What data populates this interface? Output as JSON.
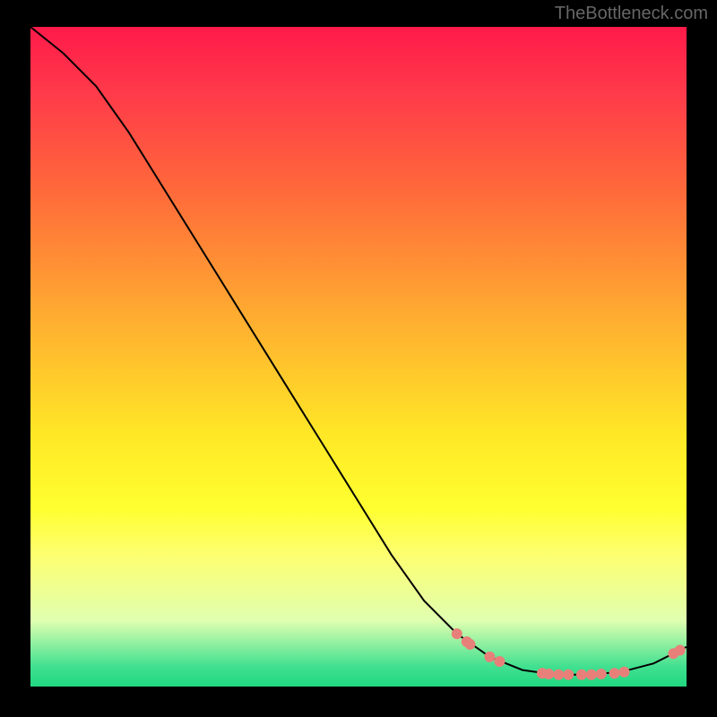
{
  "watermark": "TheBottleneck.com",
  "chart_data": {
    "type": "line",
    "title": "",
    "xlabel": "",
    "ylabel": "",
    "xlim": [
      0,
      100
    ],
    "ylim": [
      0,
      100
    ],
    "curve": [
      {
        "x": 0,
        "y": 100
      },
      {
        "x": 5,
        "y": 96
      },
      {
        "x": 10,
        "y": 91
      },
      {
        "x": 15,
        "y": 84
      },
      {
        "x": 20,
        "y": 76
      },
      {
        "x": 25,
        "y": 68
      },
      {
        "x": 30,
        "y": 60
      },
      {
        "x": 35,
        "y": 52
      },
      {
        "x": 40,
        "y": 44
      },
      {
        "x": 45,
        "y": 36
      },
      {
        "x": 50,
        "y": 28
      },
      {
        "x": 55,
        "y": 20
      },
      {
        "x": 60,
        "y": 13
      },
      {
        "x": 65,
        "y": 8
      },
      {
        "x": 70,
        "y": 4.5
      },
      {
        "x": 75,
        "y": 2.5
      },
      {
        "x": 80,
        "y": 1.8
      },
      {
        "x": 85,
        "y": 1.8
      },
      {
        "x": 90,
        "y": 2.2
      },
      {
        "x": 95,
        "y": 3.5
      },
      {
        "x": 100,
        "y": 6
      }
    ],
    "markers": [
      {
        "x": 65,
        "y": 8
      },
      {
        "x": 66.5,
        "y": 6.8
      },
      {
        "x": 67,
        "y": 6.4
      },
      {
        "x": 70,
        "y": 4.5
      },
      {
        "x": 71.5,
        "y": 3.8
      },
      {
        "x": 78,
        "y": 2.0
      },
      {
        "x": 79,
        "y": 1.9
      },
      {
        "x": 80.5,
        "y": 1.8
      },
      {
        "x": 82,
        "y": 1.8
      },
      {
        "x": 84,
        "y": 1.8
      },
      {
        "x": 85.5,
        "y": 1.8
      },
      {
        "x": 87,
        "y": 1.9
      },
      {
        "x": 89,
        "y": 2.0
      },
      {
        "x": 90.5,
        "y": 2.2
      },
      {
        "x": 98,
        "y": 5.0
      },
      {
        "x": 99,
        "y": 5.5
      }
    ]
  }
}
